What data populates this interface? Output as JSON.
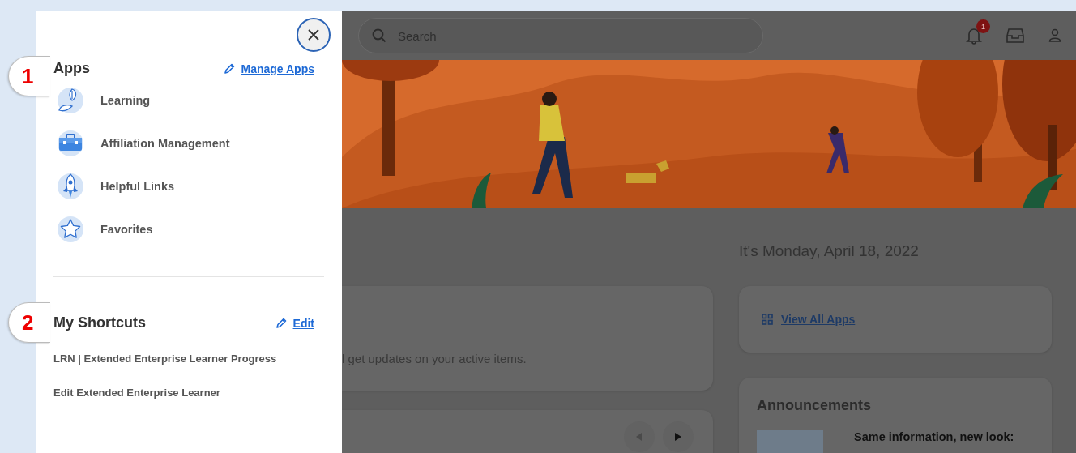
{
  "callouts": [
    "1",
    "2"
  ],
  "drawer": {
    "apps_heading": "Apps",
    "manage_link": "Manage Apps",
    "apps": [
      {
        "label": "Learning",
        "kind": "learning"
      },
      {
        "label": "Affiliation Management",
        "kind": "briefcase"
      },
      {
        "label": "Helpful Links",
        "kind": "rocket"
      },
      {
        "label": "Favorites",
        "kind": "star"
      }
    ],
    "shortcuts_heading": "My Shortcuts",
    "edit_link": "Edit",
    "shortcuts": [
      "LRN | Extended Enterprise Learner Progress",
      "Edit Extended Enterprise Learner"
    ]
  },
  "header": {
    "search_placeholder": "Search",
    "notification_count": "1"
  },
  "home": {
    "date": "It's Monday, April 18, 2022",
    "card_text": "l get updates on your active items.",
    "view_all_link": "View All Apps",
    "announcements_title": "Announcements",
    "announcement_heading": "Same information, new look:"
  }
}
